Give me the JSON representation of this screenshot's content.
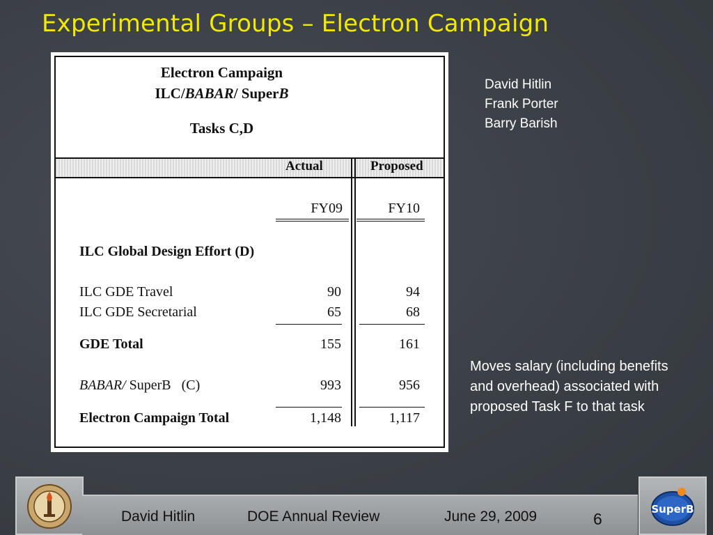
{
  "slide": {
    "title": "Experimental Groups – Electron Campaign"
  },
  "table": {
    "header_lines": [
      "Electron Campaign",
      "ILC/BABAR/ SuperB",
      "Tasks C,D"
    ],
    "col_headers": [
      "Actual",
      "Proposed"
    ],
    "years": [
      "FY09",
      "FY10"
    ],
    "section_heading": "ILC Global Design Effort (D)",
    "rows": [
      {
        "label": "ILC GDE Travel",
        "fy09": "90",
        "fy10": "94"
      },
      {
        "label": "ILC GDE Secretarial",
        "fy09": "65",
        "fy10": "68"
      },
      {
        "label": "GDE Total",
        "fy09": "155",
        "fy10": "161"
      },
      {
        "label_italic": "BABAR/",
        "label_rest": " SuperB   (C)",
        "fy09": "993",
        "fy10": "956"
      },
      {
        "label": "Electron Campaign Total",
        "fy09": "1,148",
        "fy10": "1,117"
      }
    ]
  },
  "names": [
    "David Hitlin",
    "Frank Porter",
    "Barry Barish"
  ],
  "note": "Moves salary (including benefits and overhead) associated with proposed Task F to that task",
  "footer": {
    "author": "David Hitlin",
    "event": "DOE Annual Review",
    "date": "June 29, 2009",
    "page": "6"
  },
  "logos": {
    "left": "caltech-seal-icon",
    "right": "superb-logo-icon",
    "right_text": "SuperB"
  }
}
